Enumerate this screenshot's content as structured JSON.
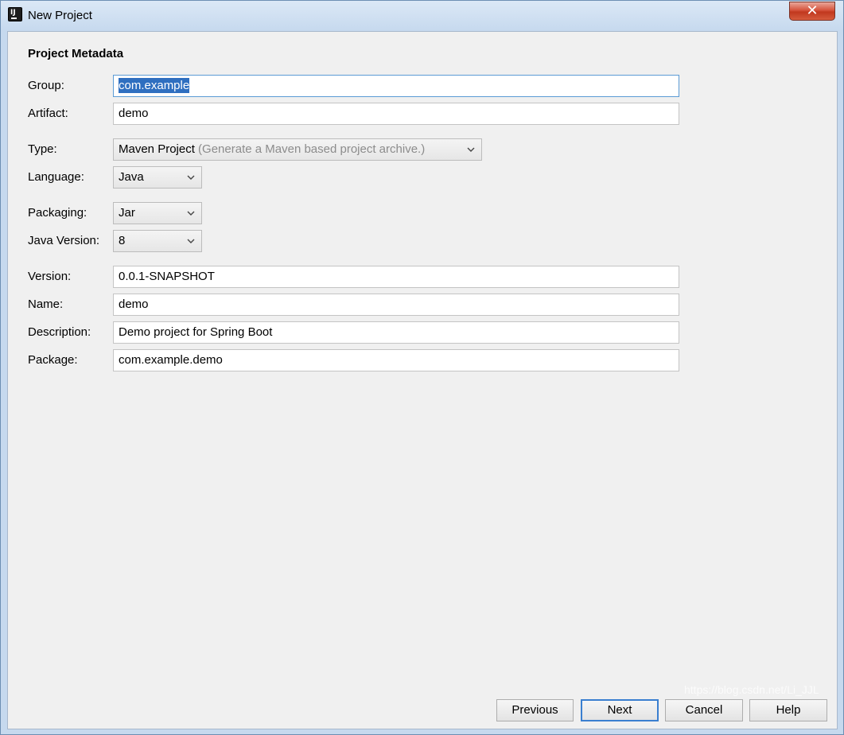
{
  "window": {
    "title": "New Project",
    "close_glyph": "✕"
  },
  "section": {
    "title": "Project Metadata"
  },
  "form": {
    "group": {
      "label": "Group:",
      "value": "com.example"
    },
    "artifact": {
      "label": "Artifact:",
      "value": "demo"
    },
    "type": {
      "label": "Type:",
      "value": "Maven Project",
      "hint": "(Generate a Maven based project archive.)"
    },
    "language": {
      "label": "Language:",
      "value": "Java"
    },
    "packaging": {
      "label": "Packaging:",
      "value": "Jar"
    },
    "java_version": {
      "label": "Java Version:",
      "value": "8"
    },
    "version": {
      "label": "Version:",
      "value": "0.0.1-SNAPSHOT"
    },
    "name": {
      "label": "Name:",
      "value": "demo"
    },
    "description": {
      "label": "Description:",
      "value": "Demo project for Spring Boot"
    },
    "package": {
      "label": "Package:",
      "value": "com.example.demo"
    }
  },
  "buttons": {
    "previous": "Previous",
    "next": "Next",
    "cancel": "Cancel",
    "help": "Help"
  },
  "watermark": "https://blog.csdn.net/Li_JJL",
  "icons": {
    "app": "intellij-idea-icon",
    "dropdown": "chevron-down-icon"
  }
}
